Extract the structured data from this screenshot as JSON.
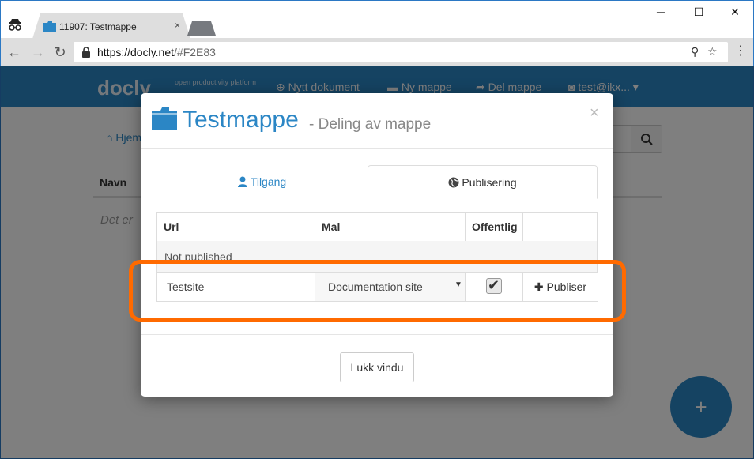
{
  "browser": {
    "tab_title": "11907: Testmappe",
    "tab_close": "×",
    "url_host": "https://docly.net",
    "url_path": "/#F2E83",
    "window_minimize": "─",
    "window_maximize": "☐",
    "window_close": "✕"
  },
  "app": {
    "logo": "docly",
    "logo_tagline": "open productivity platform",
    "nav": {
      "new_document": "Nytt dokument",
      "new_folder": "Ny mappe",
      "share_folder": "Del mappe",
      "user": "test@ikx..."
    },
    "breadcrumb_home": "Hjem",
    "column_name": "Navn",
    "empty_text": "Det er",
    "fab_label": "+"
  },
  "modal": {
    "title": "Testmappe",
    "subtitle": "- Deling av mappe",
    "close": "×",
    "tabs": [
      {
        "label": "Tilgang",
        "active": false
      },
      {
        "label": "Publisering",
        "active": true
      }
    ],
    "table": {
      "headers": [
        "Url",
        "Mal",
        "Offentlig",
        ""
      ],
      "status_row": "Not published",
      "edit_row": {
        "site_value": "Testsite",
        "template_value": "Documentation site",
        "public_checked": true,
        "publish_label": "Publiser"
      }
    },
    "footer_button": "Lukk vindu"
  },
  "colors": {
    "accent": "#2b86c5",
    "highlight": "#ff6a00"
  }
}
